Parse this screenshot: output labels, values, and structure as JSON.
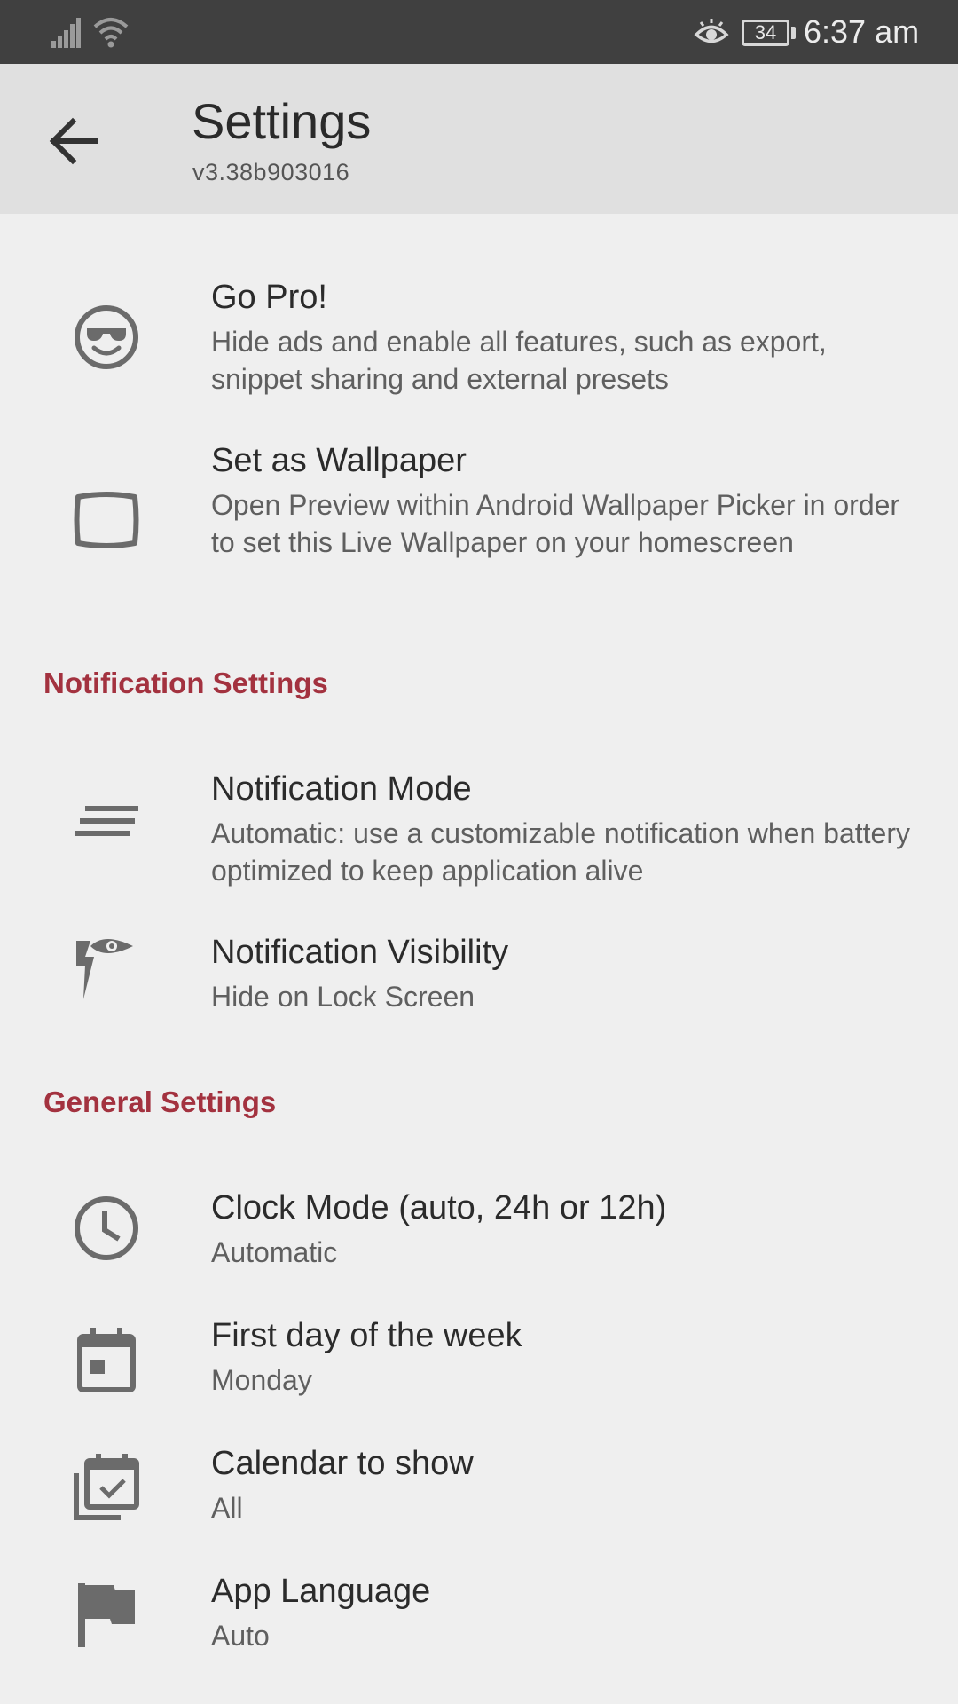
{
  "status_bar": {
    "battery_level": "34",
    "time": "6:37 am"
  },
  "app_bar": {
    "title": "Settings",
    "subtitle": "v3.38b903016"
  },
  "top_items": [
    {
      "title": "Go Pro!",
      "summary": "Hide ads and enable all features, such as export, snippet sharing and external presets",
      "icon": "sunglasses-face-icon"
    },
    {
      "title": "Set as Wallpaper",
      "summary": "Open Preview within Android Wallpaper Picker in order to set this Live Wallpaper on your homescreen",
      "icon": "screen-icon"
    }
  ],
  "notification_section": {
    "header": "Notification Settings",
    "items": [
      {
        "title": "Notification Mode",
        "summary": "Automatic: use a customizable notification when battery optimized to keep application alive",
        "icon": "notes-icon"
      },
      {
        "title": "Notification Visibility",
        "summary": "Hide on Lock Screen",
        "icon": "flash-eye-icon"
      }
    ]
  },
  "general_section": {
    "header": "General Settings",
    "items": [
      {
        "title": "Clock Mode (auto, 24h or 12h)",
        "summary": "Automatic",
        "icon": "clock-icon"
      },
      {
        "title": "First day of the week",
        "summary": "Monday",
        "icon": "calendar-day-icon"
      },
      {
        "title": "Calendar to show",
        "summary": "All",
        "icon": "calendar-multiple-check-icon"
      },
      {
        "title": "App Language",
        "summary": "Auto",
        "icon": "flag-icon"
      }
    ]
  },
  "colors": {
    "accent": "#a3323f",
    "icon": "#6b6b6b",
    "status_bar": "#404040",
    "app_bar": "#e0e0e0",
    "background": "#efefef"
  }
}
